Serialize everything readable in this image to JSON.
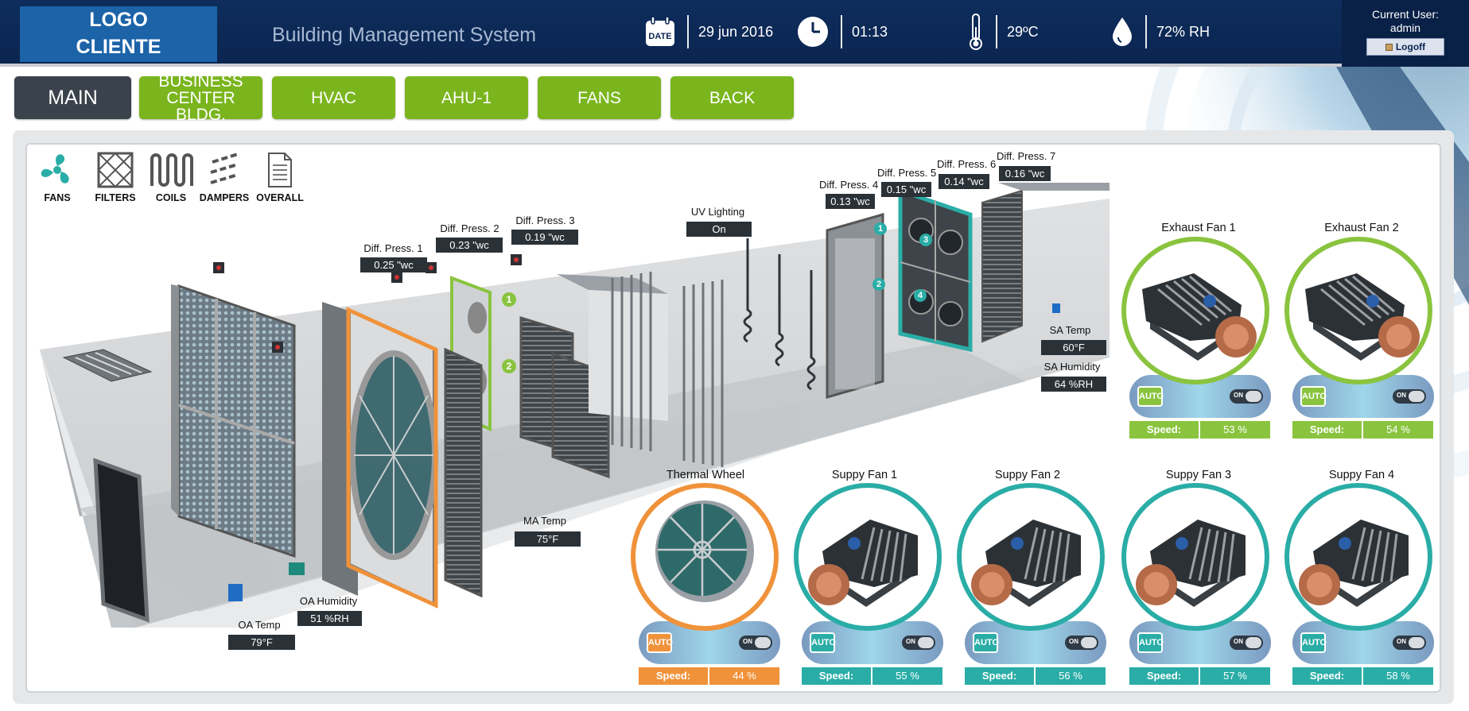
{
  "header": {
    "logo_line1": "LOGO",
    "logo_line2": "CLIENTE",
    "title": "Building Management System",
    "date_icon_label": "DATE",
    "date": "29 jun 2016",
    "time": "01:13",
    "temperature": "29ºC",
    "humidity": "72% RH",
    "user_label": "Current User:",
    "user_name": "admin",
    "logoff_label": "Logoff"
  },
  "nav": {
    "main": "MAIN",
    "business_line1": "BUSINESS",
    "business_line2": "CENTER BLDG.",
    "hvac": "HVAC",
    "ahu": "AHU-1",
    "fans": "FANS",
    "back": "BACK"
  },
  "legend": {
    "fans": "FANS",
    "filters": "FILTERS",
    "coils": "COILS",
    "dampers": "DAMPERS",
    "overall": "OVERALL"
  },
  "sensors": {
    "dp1_label": "Diff. Press. 1",
    "dp1_value": "0.25 \"wc",
    "dp2_label": "Diff. Press. 2",
    "dp2_value": "0.23 \"wc",
    "dp3_label": "Diff. Press. 3",
    "dp3_value": "0.19 \"wc",
    "dp4_label": "Diff. Press. 4",
    "dp4_value": "0.13 \"wc",
    "dp5_label": "Diff. Press. 5",
    "dp5_value": "0.15 \"wc",
    "dp6_label": "Diff. Press. 6",
    "dp6_value": "0.14 \"wc",
    "dp7_label": "Diff. Press. 7",
    "dp7_value": "0.16 \"wc",
    "uv_label": "UV Lighting",
    "uv_value": "On",
    "sa_temp_label": "SA Temp",
    "sa_temp_value": "60°F",
    "sa_hum_label": "SA Humidity",
    "sa_hum_value": "64 %RH",
    "ma_temp_label": "MA Temp",
    "ma_temp_value": "75°F",
    "oa_hum_label": "OA Humidity",
    "oa_hum_value": "51 %RH",
    "oa_temp_label": "OA Temp",
    "oa_temp_value": "79°F"
  },
  "markers": {
    "m1": "1",
    "m2": "2",
    "m3": "3",
    "m4": "4"
  },
  "fans": {
    "exhaust1": {
      "title": "Exhaust Fan 1",
      "auto": "AUTO",
      "on": "ON",
      "speed_label": "Speed:",
      "speed": "53 %"
    },
    "exhaust2": {
      "title": "Exhaust Fan 2",
      "auto": "AUTO",
      "on": "ON",
      "speed_label": "Speed:",
      "speed": "54 %"
    },
    "thermal": {
      "title": "Thermal Wheel",
      "auto": "AUTO",
      "on": "ON",
      "speed_label": "Speed:",
      "speed": "44 %"
    },
    "supply1": {
      "title": "Suppy Fan 1",
      "auto": "AUTO",
      "on": "ON",
      "speed_label": "Speed:",
      "speed": "55 %"
    },
    "supply2": {
      "title": "Suppy Fan 2",
      "auto": "AUTO",
      "on": "ON",
      "speed_label": "Speed:",
      "speed": "56 %"
    },
    "supply3": {
      "title": "Suppy Fan 3",
      "auto": "AUTO",
      "on": "ON",
      "speed_label": "Speed:",
      "speed": "57 %"
    },
    "supply4": {
      "title": "Suppy Fan 4",
      "auto": "AUTO",
      "on": "ON",
      "speed_label": "Speed:",
      "speed": "58 %"
    }
  },
  "colors": {
    "header_bg": "#0b2550",
    "nav_green": "#7ab51d",
    "nav_dark": "#3a434c",
    "fan_green": "#8ac43f",
    "fan_teal": "#2aada6",
    "fan_orange": "#f0923a",
    "value_box": "#2a3238"
  }
}
